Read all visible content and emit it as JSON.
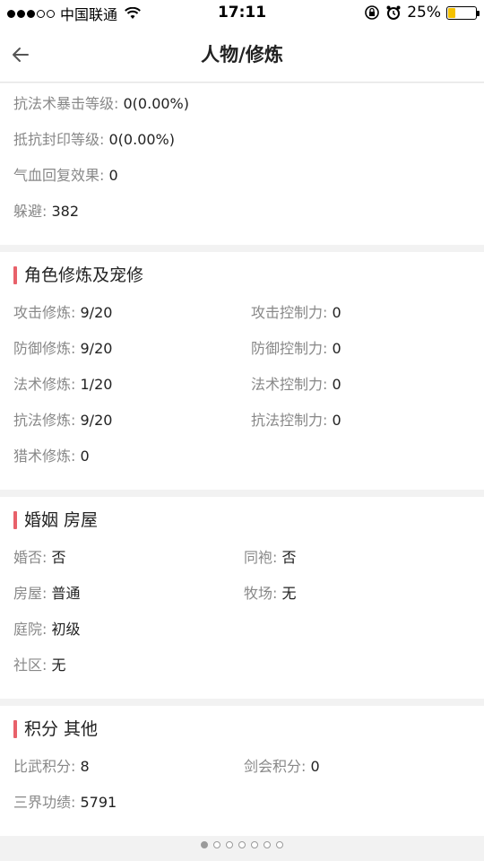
{
  "status_bar": {
    "carrier": "中国联通",
    "time": "17:11",
    "battery": "25%",
    "battery_level": 0.25
  },
  "nav": {
    "title": "人物/修炼"
  },
  "section_top": {
    "rows": [
      {
        "label": "抗法术暴击等级:",
        "value": "0(0.00%)"
      },
      {
        "label": "抵抗封印等级:",
        "value": "0(0.00%)"
      },
      {
        "label": "气血回复效果:",
        "value": "0"
      },
      {
        "label": "躲避:",
        "value": "382"
      }
    ]
  },
  "section_cultivation": {
    "title": "角色修炼及宠修",
    "left": [
      {
        "label": "攻击修炼:",
        "value": "9/20"
      },
      {
        "label": "防御修炼:",
        "value": "9/20"
      },
      {
        "label": "法术修炼:",
        "value": "1/20"
      },
      {
        "label": "抗法修炼:",
        "value": "9/20"
      },
      {
        "label": "猎术修炼:",
        "value": "0"
      }
    ],
    "right": [
      {
        "label": "攻击控制力:",
        "value": "0"
      },
      {
        "label": "防御控制力:",
        "value": "0"
      },
      {
        "label": "法术控制力:",
        "value": "0"
      },
      {
        "label": "抗法控制力:",
        "value": "0"
      }
    ]
  },
  "section_marriage": {
    "title": "婚姻 房屋",
    "left": [
      {
        "label": "婚否:",
        "value": "否"
      },
      {
        "label": "房屋:",
        "value": "普通"
      },
      {
        "label": "庭院:",
        "value": "初级"
      },
      {
        "label": "社区:",
        "value": "无"
      }
    ],
    "right": [
      {
        "label": "同袍:",
        "value": "否"
      },
      {
        "label": "牧场:",
        "value": "无"
      }
    ]
  },
  "section_points": {
    "title": "积分 其他",
    "left": [
      {
        "label": "比武积分:",
        "value": "8"
      },
      {
        "label": "三界功绩:",
        "value": "5791"
      }
    ],
    "right": [
      {
        "label": "剑会积分:",
        "value": "0"
      }
    ]
  },
  "pager": {
    "count": 7,
    "active_index": 0
  },
  "colors": {
    "accent": "#e8616a",
    "battery": "#f5c200"
  }
}
